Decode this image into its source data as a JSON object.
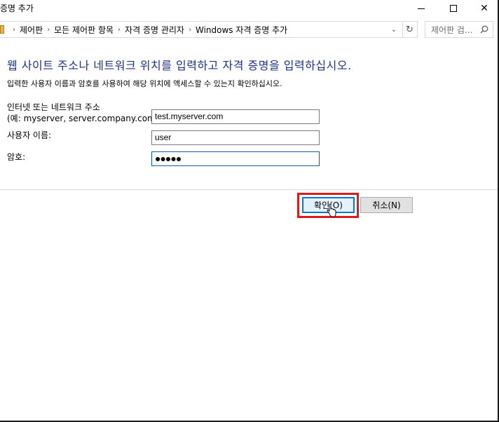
{
  "window": {
    "title": "증명 추가"
  },
  "address_bar": {
    "crumbs": [
      "제어판",
      "모든 제어판 항목",
      "자격 증명 관리자",
      "Windows 자격 증명 추가"
    ]
  },
  "search": {
    "placeholder": "제어판 검..."
  },
  "main": {
    "heading": "웹 사이트 주소나 네트워크 위치를 입력하고 자격 증명을 입력하십시오.",
    "subtext": "입력한 사용자 이름과 암호를 사용하여 해당 위치에 액세스할 수 있는지 확인하십시오."
  },
  "form": {
    "address_label": "인터넷 또는 네트워크 주소",
    "address_hint": "(예: myserver, server.company.com):",
    "address_value": "test.myserver.com",
    "username_label": "사용자 이름:",
    "username_value": "user",
    "password_label": "암호:",
    "password_value": "●●●●●"
  },
  "buttons": {
    "ok_label": "확인(O)",
    "cancel_label": "취소(N)"
  },
  "colors": {
    "heading": "#1e3287",
    "highlight": "#e01919",
    "focus_border": "#0078d7"
  }
}
